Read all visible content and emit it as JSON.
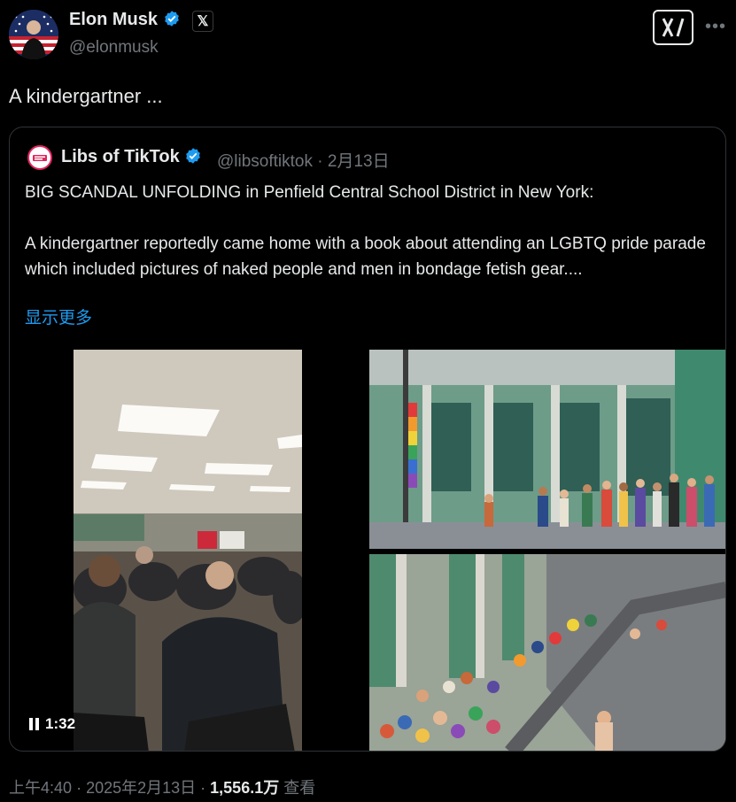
{
  "post": {
    "author_name": "Elon Musk",
    "author_handle": "@elonmusk",
    "x_badge": "𝕏",
    "text": "A kindergartner ..."
  },
  "quote": {
    "author_name": "Libs of TikTok",
    "author_handle": "@libsoftiktok",
    "date": "2月13日",
    "handle_date": "@libsoftiktok · 2月13日",
    "line1": "BIG SCANDAL UNFOLDING in Penfield Central School District in New York:",
    "line2": "A kindergartner reportedly came home with a book about attending an LGBTQ pride parade which included pictures of naked people and men in bondage fetish gear....",
    "show_more": "显示更多",
    "video_duration": "1:32"
  },
  "footer": {
    "time": "上午4:40",
    "date": "2025年2月13日",
    "views": "1,556.1万",
    "views_label": "查看"
  },
  "colors": {
    "background": "#000000",
    "text": "#e7e9ea",
    "muted": "#71767b",
    "link": "#1d9bf0",
    "verified": "#1d9bf0",
    "border": "#2f3336"
  },
  "icons": [
    "verified-badge-icon",
    "x-logo-icon",
    "grok-icon",
    "more-icon",
    "pause-icon"
  ]
}
